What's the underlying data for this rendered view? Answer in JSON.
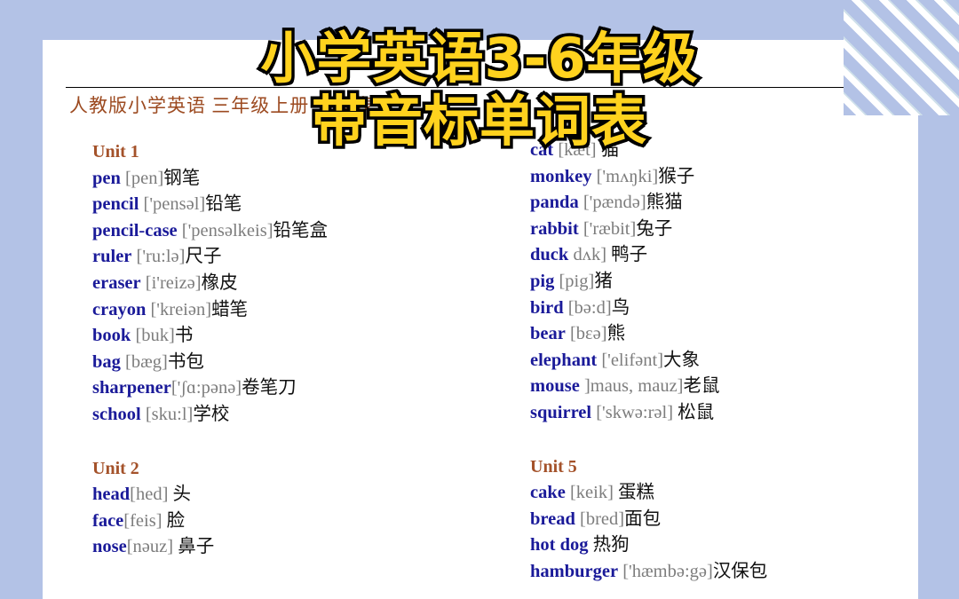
{
  "background": {
    "color": "#b3c2e6",
    "corner_decoration": "diagonal-stripes"
  },
  "overlay_title": {
    "line1": "小学英语3-6年级",
    "line2": "带音标单词表",
    "text_color": "#FFD21E",
    "outline_color": "#000000"
  },
  "document": {
    "header": "人教版小学英语 三年级上册 单词表",
    "header_color": "#9c4a20",
    "word_color": "#1a1a99",
    "phonetic_color": "#7d7d7d",
    "unit_color": "#a4522a",
    "columns": [
      {
        "id": "left-column",
        "blocks": [
          {
            "type": "unit",
            "label": "Unit 1",
            "entries": [
              {
                "word": "pen",
                "phonetic": " [pen]",
                "chinese": "钢笔"
              },
              {
                "word": "pencil",
                "phonetic": " ['pensəl]",
                "chinese": "铅笔"
              },
              {
                "word": "pencil-case",
                "phonetic": " ['pensəlkeis]",
                "chinese": "铅笔盒"
              },
              {
                "word": "ruler",
                "phonetic": " ['ru:lə]",
                "chinese": "尺子"
              },
              {
                "word": "eraser",
                "phonetic": " [i'reizə]",
                "chinese": "橡皮"
              },
              {
                "word": "crayon",
                "phonetic": " ['kreiən]",
                "chinese": "蜡笔"
              },
              {
                "word": "book",
                "phonetic": " [buk]",
                "chinese": "书"
              },
              {
                "word": "bag",
                "phonetic": " [bæg]",
                "chinese": "书包"
              },
              {
                "word": "sharpener",
                "phonetic": "['ʃɑ:pənə]",
                "chinese": "卷笔刀"
              },
              {
                "word": "school",
                "phonetic": " [sku:l]",
                "chinese": "学校"
              }
            ]
          },
          {
            "type": "unit",
            "label": "Unit 2",
            "entries": [
              {
                "word": "head",
                "phonetic": "[hed]",
                "chinese": "  头"
              },
              {
                "word": "face",
                "phonetic": "[feis]",
                "chinese": " 脸"
              },
              {
                "word": "nose",
                "phonetic": "[nəuz]",
                "chinese": " 鼻子"
              }
            ]
          }
        ]
      },
      {
        "id": "right-column",
        "blocks": [
          {
            "type": "unit",
            "label": "",
            "entries": [
              {
                "word": "cat",
                "phonetic": " [kæt]",
                "chinese": " 猫"
              },
              {
                "word": "monkey",
                "phonetic": " ['mʌŋki]",
                "chinese": "猴子"
              },
              {
                "word": "panda",
                "phonetic": " ['pændə]",
                "chinese": "熊猫"
              },
              {
                "word": "rabbit",
                "phonetic": " ['ræbit]",
                "chinese": "兔子"
              },
              {
                "word": "duck",
                "phonetic": " dʌk]",
                "chinese": " 鸭子"
              },
              {
                "word": "pig",
                "phonetic": " [pig]",
                "chinese": "猪"
              },
              {
                "word": "bird",
                "phonetic": " [bə:d]",
                "chinese": "鸟"
              },
              {
                "word": "bear",
                "phonetic": " [bɛə]",
                "chinese": "熊"
              },
              {
                "word": "elephant",
                "phonetic": " ['elifənt]",
                "chinese": "大象"
              },
              {
                "word": "mouse",
                "phonetic": " ]maus, mauz]",
                "chinese": "老鼠"
              },
              {
                "word": "squirrel",
                "phonetic": " ['skwə:rəl]",
                "chinese": " 松鼠"
              }
            ]
          },
          {
            "type": "unit",
            "label": "Unit 5",
            "entries": [
              {
                "word": "cake",
                "phonetic": " [keik]",
                "chinese": " 蛋糕"
              },
              {
                "word": "bread",
                "phonetic": " [bred]",
                "chinese": "面包"
              },
              {
                "word": "hot dog",
                "phonetic": "",
                "chinese": " 热狗"
              },
              {
                "word": "hamburger",
                "phonetic": " ['hæmbə:gə]",
                "chinese": "汉保包"
              }
            ]
          }
        ]
      }
    ]
  }
}
